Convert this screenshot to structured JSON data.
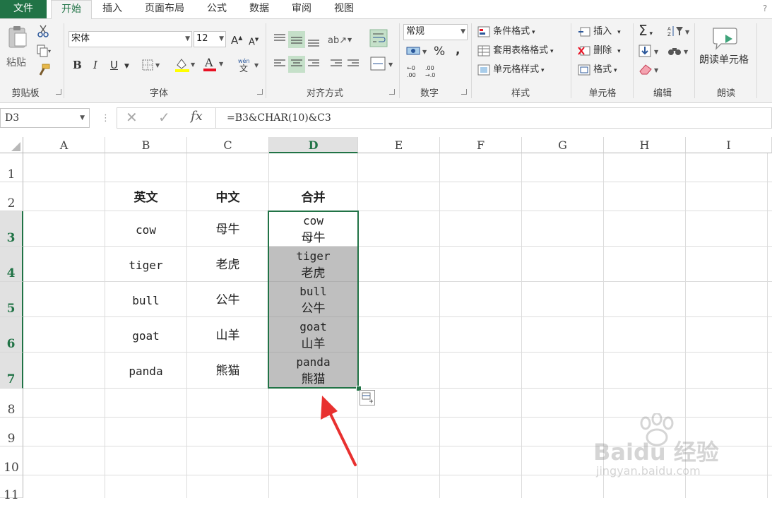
{
  "tabs": [
    "文件",
    "开始",
    "插入",
    "页面布局",
    "公式",
    "数据",
    "审阅",
    "视图"
  ],
  "ribbon": {
    "clipboard": {
      "paste": "粘贴",
      "label": "剪贴板"
    },
    "font": {
      "name": "宋体",
      "size": "12",
      "bold": "B",
      "italic": "I",
      "underline": "U",
      "label": "字体"
    },
    "alignment": {
      "label": "对齐方式"
    },
    "number": {
      "format": "常规",
      "percent": "%",
      "comma": ",",
      "label": "数字"
    },
    "styles": {
      "conditional": "条件格式",
      "table": "套用表格格式",
      "cell_styles": "单元格样式",
      "label": "样式"
    },
    "cells": {
      "insert": "插入",
      "delete": "删除",
      "format": "格式",
      "label": "单元格"
    },
    "editing": {
      "label": "编辑"
    },
    "read": {
      "button": "朗读单元格",
      "label": "朗读"
    }
  },
  "formula_bar": {
    "name_box": "D3",
    "fx": "fx",
    "formula": "=B3&CHAR(10)&C3"
  },
  "columns": [
    "A",
    "B",
    "C",
    "D",
    "E",
    "F",
    "G",
    "H",
    "I"
  ],
  "rows": [
    "1",
    "2",
    "3",
    "4",
    "5",
    "6",
    "7",
    "8",
    "9",
    "10",
    "11"
  ],
  "headers": {
    "b": "英文",
    "c": "中文",
    "d": "合并"
  },
  "data": [
    {
      "en": "cow",
      "zh": "母牛"
    },
    {
      "en": "tiger",
      "zh": "老虎"
    },
    {
      "en": "bull",
      "zh": "公牛"
    },
    {
      "en": "goat",
      "zh": "山羊"
    },
    {
      "en": "panda",
      "zh": "熊猫"
    }
  ],
  "watermark": {
    "brand": "Baidu 经验",
    "url": "jingyan.baidu.com"
  },
  "colors": {
    "excel_green": "#217346",
    "selection_fill": "#bfbfbf",
    "arrow": "#e8302f"
  }
}
